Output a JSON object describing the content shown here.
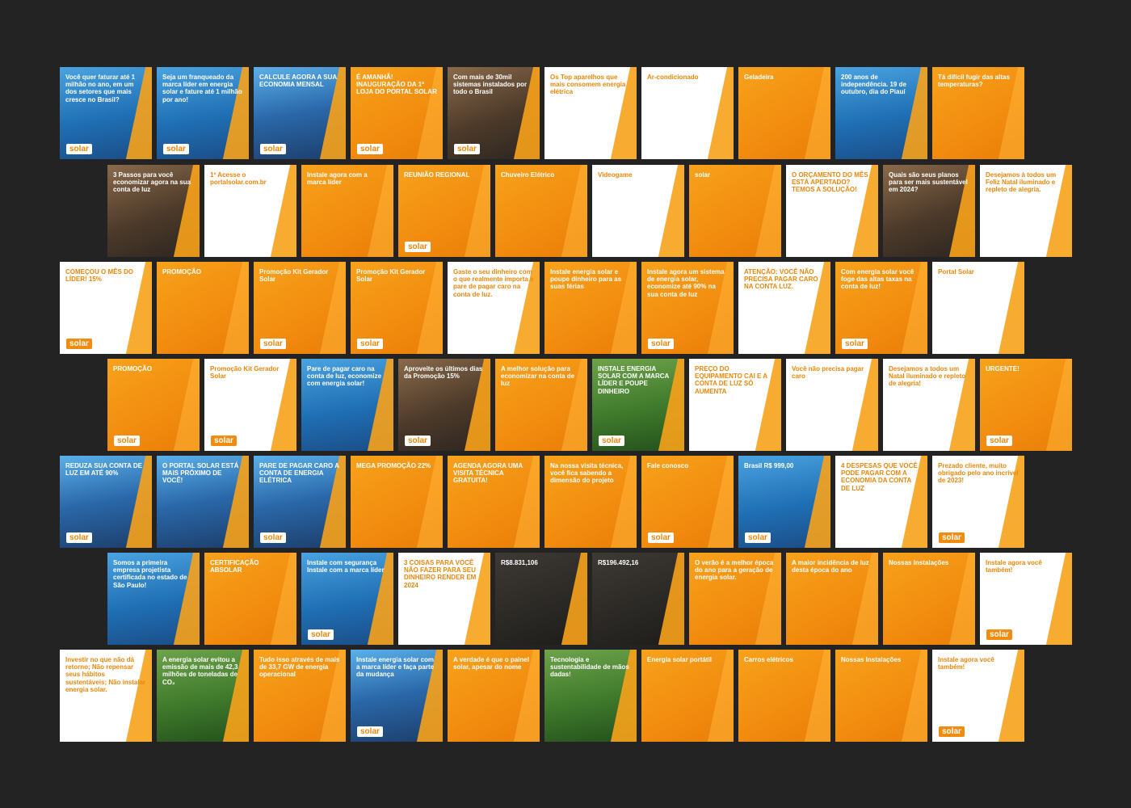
{
  "rows": [
    {
      "tiles": [
        {
          "theme": "t-blue",
          "text": "Você quer faturar até 1 milhão no ano, em um dos setores que mais cresce no Brasil?",
          "logo": "solar"
        },
        {
          "theme": "t-blue",
          "text": "Seja um franqueado da marca líder em energia solar e fature até 1 milhão por ano!",
          "logo": "solar"
        },
        {
          "theme": "t-panel",
          "text": "CALCULE AGORA A SUA ECONOMIA MENSAL",
          "logo": "solar"
        },
        {
          "theme": "t-orange",
          "text": "É AMANHÃ! INAUGURAÇÃO DA 1ª LOJA DO PORTAL SOLAR",
          "logo": "solar"
        },
        {
          "theme": "t-photo",
          "text": "Com mais de 30mil sistemas instalados por todo o Brasil",
          "logo": "solar"
        },
        {
          "theme": "t-white",
          "text": "Os Top aparelhos que mais consomem energia elétrica",
          "logo": ""
        },
        {
          "theme": "t-white",
          "text": "Ar-condicionado",
          "logo": ""
        },
        {
          "theme": "t-orange",
          "text": "Geladeira",
          "logo": ""
        },
        {
          "theme": "t-blue",
          "text": "200 anos de independência. 19 de outubro, dia do Piauí",
          "logo": ""
        },
        {
          "theme": "t-orange",
          "text": "Tá difícil fugir das altas temperaturas?",
          "logo": ""
        }
      ]
    },
    {
      "tiles": [
        {
          "theme": "t-photo",
          "text": "3 Passos para você economizar agora na sua conta de luz",
          "logo": ""
        },
        {
          "theme": "t-white",
          "text": "1º Acesse o portalsolar.com.br",
          "logo": ""
        },
        {
          "theme": "t-orange",
          "text": "Instale agora com a marca líder",
          "logo": ""
        },
        {
          "theme": "t-orange",
          "text": "REUNIÃO REGIONAL",
          "logo": "solar"
        },
        {
          "theme": "t-orange",
          "text": "Chuveiro Elétrico",
          "logo": ""
        },
        {
          "theme": "t-white",
          "text": "Videogame",
          "logo": ""
        },
        {
          "theme": "t-orange",
          "text": "solar",
          "logo": ""
        },
        {
          "theme": "t-white",
          "text": "O ORÇAMENTO DO MÊS ESTÁ APERTADO? TEMOS A SOLUÇÃO!",
          "logo": ""
        },
        {
          "theme": "t-photo",
          "text": "Quais são seus planos para ser mais sustentável em 2024?",
          "logo": ""
        },
        {
          "theme": "t-white",
          "text": "Desejamos à todos um Feliz Natal iluminado e repleto de alegria.",
          "logo": ""
        }
      ]
    },
    {
      "tiles": [
        {
          "theme": "t-white",
          "text": "COMEÇOU O MÊS DO LÍDER! 15%",
          "logo": "solar"
        },
        {
          "theme": "t-orange",
          "text": "PROMOÇÃO",
          "logo": ""
        },
        {
          "theme": "t-orange",
          "text": "Promoção Kit Gerador Solar",
          "logo": "solar"
        },
        {
          "theme": "t-orange",
          "text": "Promoção Kit Gerador Solar",
          "logo": "solar"
        },
        {
          "theme": "t-white",
          "text": "Gaste o seu dinheiro com o que realmente importa e pare de pagar caro na conta de luz.",
          "logo": ""
        },
        {
          "theme": "t-orange",
          "text": "Instale energia solar e poupe dinheiro para as suas férias",
          "logo": ""
        },
        {
          "theme": "t-orange",
          "text": "Instale agora um sistema de energia solar, economize até 90% na sua conta de luz",
          "logo": "solar"
        },
        {
          "theme": "t-white",
          "text": "ATENÇÃO: VOCÊ NÃO PRECISA PAGAR CARO NA CONTA LUZ.",
          "logo": ""
        },
        {
          "theme": "t-orange",
          "text": "Com energia solar você foge das altas taxas na conta de luz!",
          "logo": "solar"
        },
        {
          "theme": "t-white",
          "text": "Portal Solar",
          "logo": ""
        }
      ]
    },
    {
      "tiles": [
        {
          "theme": "t-orange",
          "text": "PROMOÇÃO",
          "logo": "solar"
        },
        {
          "theme": "t-white",
          "text": "Promoção Kit Gerador Solar",
          "logo": "solar"
        },
        {
          "theme": "t-blue",
          "text": "Pare de pagar caro na conta de luz, economize com energia solar!",
          "logo": ""
        },
        {
          "theme": "t-photo",
          "text": "Aproveite os últimos dias da Promoção 15%",
          "logo": "solar"
        },
        {
          "theme": "t-orange",
          "text": "A melhor solução para economizar na conta de luz",
          "logo": ""
        },
        {
          "theme": "t-green",
          "text": "INSTALE ENERGIA SOLAR COM A MARCA LÍDER E POUPE DINHEIRO",
          "logo": "solar"
        },
        {
          "theme": "t-white",
          "text": "PREÇO DO EQUIPAMENTO CAI E A CONTA DE LUZ SÓ AUMENTA",
          "logo": ""
        },
        {
          "theme": "t-white",
          "text": "Você não precisa pagar caro",
          "logo": ""
        },
        {
          "theme": "t-white",
          "text": "Desejamos a todos um Natal iluminado e repleto de alegria!",
          "logo": ""
        },
        {
          "theme": "t-orange",
          "text": "URGENTE!",
          "logo": "solar"
        }
      ]
    },
    {
      "tiles": [
        {
          "theme": "t-panel",
          "text": "REDUZA SUA CONTA DE LUZ EM ATÉ 90%",
          "logo": "solar"
        },
        {
          "theme": "t-panel",
          "text": "O PORTAL SOLAR ESTÁ MAIS PRÓXIMO DE VOCÊ!",
          "logo": ""
        },
        {
          "theme": "t-panel",
          "text": "PARE DE PAGAR CARO A CONTA DE ENERGIA ELÉTRICA",
          "logo": "solar"
        },
        {
          "theme": "t-orange",
          "text": "MEGA PROMOÇÃO 22%",
          "logo": ""
        },
        {
          "theme": "t-orange",
          "text": "AGENDA AGORA UMA VISITA TÉCNICA GRATUITA!",
          "logo": ""
        },
        {
          "theme": "t-orange",
          "text": "Na nossa visita técnica, você fica sabendo a dimensão do projeto",
          "logo": ""
        },
        {
          "theme": "t-orange",
          "text": "Fale conosco",
          "logo": "solar"
        },
        {
          "theme": "t-blue",
          "text": "Brasil R$ 999,00",
          "logo": "solar"
        },
        {
          "theme": "t-white",
          "text": "4 DESPESAS QUE VOCÊ PODE PAGAR COM A ECONOMIA DA CONTA DE LUZ",
          "logo": ""
        },
        {
          "theme": "t-white",
          "text": "Prezado cliente, muito obrigado pelo ano incrível de 2023!",
          "logo": "solar"
        }
      ]
    },
    {
      "tiles": [
        {
          "theme": "t-blue",
          "text": "Somos a primeira empresa projetista certificada no estado de São Paulo!",
          "logo": ""
        },
        {
          "theme": "t-orange",
          "text": "CERTIFICAÇÃO ABSOLAR",
          "logo": ""
        },
        {
          "theme": "t-blue",
          "text": "Instale com segurança Instale com a marca líder",
          "logo": "solar"
        },
        {
          "theme": "t-white",
          "text": "3 COISAS PARA VOCÊ NÃO FAZER PARA SEU DINHEIRO RENDER EM 2024",
          "logo": ""
        },
        {
          "theme": "t-dark",
          "text": "R$8.831,106",
          "logo": ""
        },
        {
          "theme": "t-dark",
          "text": "R$196.492,16",
          "logo": ""
        },
        {
          "theme": "t-orange",
          "text": "O verão é a melhor época do ano para a geração de energia solar.",
          "logo": ""
        },
        {
          "theme": "t-orange",
          "text": "A maior incidência de luz desta época do ano",
          "logo": ""
        },
        {
          "theme": "t-orange",
          "text": "Nossas Instalações",
          "logo": ""
        },
        {
          "theme": "t-white",
          "text": "Instale agora você também!",
          "logo": "solar"
        }
      ]
    },
    {
      "tiles": [
        {
          "theme": "t-white",
          "text": "Investir no que não dá retorno; Não repensar seus hábitos sustentáveis; Não instalar energia solar.",
          "logo": ""
        },
        {
          "theme": "t-green",
          "text": "A energia solar evitou a emissão de mais de 42,3 milhões de toneladas de CO₂",
          "logo": ""
        },
        {
          "theme": "t-orange",
          "text": "Tudo isso através de mais de 33,7 GW de energia operacional",
          "logo": ""
        },
        {
          "theme": "t-panel",
          "text": "Instale energia solar com a marca líder e faça parte da mudança",
          "logo": "solar"
        },
        {
          "theme": "t-orange",
          "text": "A verdade é que o painel solar, apesar do nome",
          "logo": ""
        },
        {
          "theme": "t-green",
          "text": "Tecnologia e sustentabilidade de mãos dadas!",
          "logo": ""
        },
        {
          "theme": "t-orange",
          "text": "Energia solar portátil",
          "logo": ""
        },
        {
          "theme": "t-orange",
          "text": "Carros elétricos",
          "logo": ""
        },
        {
          "theme": "t-orange",
          "text": "Nossas Instalações",
          "logo": ""
        },
        {
          "theme": "t-white",
          "text": "Instale agora você também!",
          "logo": "solar"
        }
      ]
    }
  ]
}
